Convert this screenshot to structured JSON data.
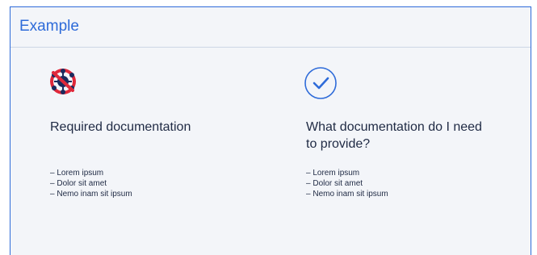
{
  "card": {
    "title": "Example"
  },
  "left": {
    "icon": "no-virus-icon",
    "heading": "Required documentation",
    "items": [
      "Lorem ipsum",
      "Dolor sit amet",
      "Nemo inam sit ipsum"
    ]
  },
  "right": {
    "icon": "check-circle-icon",
    "heading": "What documentation do I need to provide?",
    "items": [
      "Lorem ipsum",
      "Dolor sit amet",
      "Nemo inam sit ipsum"
    ]
  },
  "colors": {
    "accent": "#2e6bd9",
    "background": "#f3f5f9",
    "text": "#1f2a44",
    "icon_red": "#e0283a",
    "icon_navy": "#1b2a5e"
  }
}
